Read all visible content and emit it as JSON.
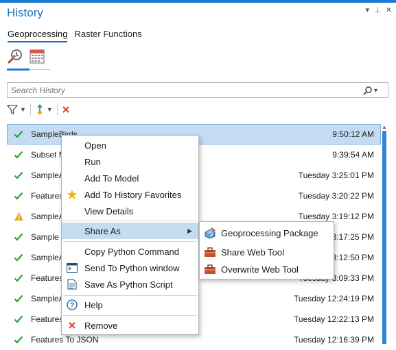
{
  "pane": {
    "title": "History",
    "controls": {
      "dropdown": "▾",
      "pin": "⊥",
      "close": "✕"
    }
  },
  "tabs": [
    {
      "label": "Geoprocessing",
      "active": true
    },
    {
      "label": "Raster Functions",
      "active": false
    }
  ],
  "view_icons": [
    "history-clock-icon",
    "calendar-icon"
  ],
  "search": {
    "placeholder": "Search History"
  },
  "toolbar": {
    "filter_icon": "filter-icon",
    "sort_icon": "sort-icon",
    "remove_icon": "delete-x-icon"
  },
  "history": [
    {
      "name": "SampleBirds",
      "time": "9:50:12 AM",
      "status": "success",
      "selected": true
    },
    {
      "name": "Subset M",
      "time": "9:39:54 AM",
      "status": "success"
    },
    {
      "name": "SampleA",
      "time": "Tuesday 3:25:01 PM",
      "status": "success"
    },
    {
      "name": "Features",
      "time": "Tuesday 3:20:22 PM",
      "status": "success"
    },
    {
      "name": "SampleA",
      "time": "Tuesday 3:19:12 PM",
      "status": "warning"
    },
    {
      "name": "Sample",
      "time": "3:17:25 PM",
      "status": "success"
    },
    {
      "name": "SampleA",
      "time": "3:12:50 PM",
      "status": "success"
    },
    {
      "name": "Features",
      "time": "Tuesday 3:09:33 PM",
      "status": "success"
    },
    {
      "name": "SampleA",
      "time": "Tuesday 12:24:19 PM",
      "status": "success"
    },
    {
      "name": "Features",
      "time": "Tuesday 12:22:13 PM",
      "status": "success"
    },
    {
      "name": "Features To JSON",
      "time": "Tuesday 12:16:39 PM",
      "status": "success"
    }
  ],
  "context_menu": {
    "items": [
      {
        "label": "Open"
      },
      {
        "label": "Run"
      },
      {
        "label": "Add To Model"
      },
      {
        "label": "Add To History Favorites",
        "icon": "star-icon"
      },
      {
        "label": "View Details"
      },
      {
        "label": "Share As",
        "submenu": true
      },
      {
        "label": "Copy Python Command"
      },
      {
        "label": "Send To Python window",
        "icon": "python-window-icon"
      },
      {
        "label": "Save As Python Script",
        "icon": "python-script-icon"
      },
      {
        "label": "Help",
        "icon": "help-icon"
      },
      {
        "label": "Remove",
        "icon": "remove-icon"
      }
    ]
  },
  "submenu": {
    "items": [
      {
        "label": "Geoprocessing Package",
        "icon": "geoprocessing-package-icon"
      },
      {
        "label": "Share Web Tool",
        "icon": "share-web-tool-icon"
      },
      {
        "label": "Overwrite Web Tool",
        "icon": "overwrite-web-tool-icon"
      }
    ]
  },
  "colors": {
    "accent": "#1c7cd5",
    "success": "#2e9e3e",
    "warning": "#e8a317",
    "remove": "#d0462f",
    "star": "#f2b705",
    "selected_row": "#c3dcf3",
    "menu_hover": "#c5dcf0"
  }
}
